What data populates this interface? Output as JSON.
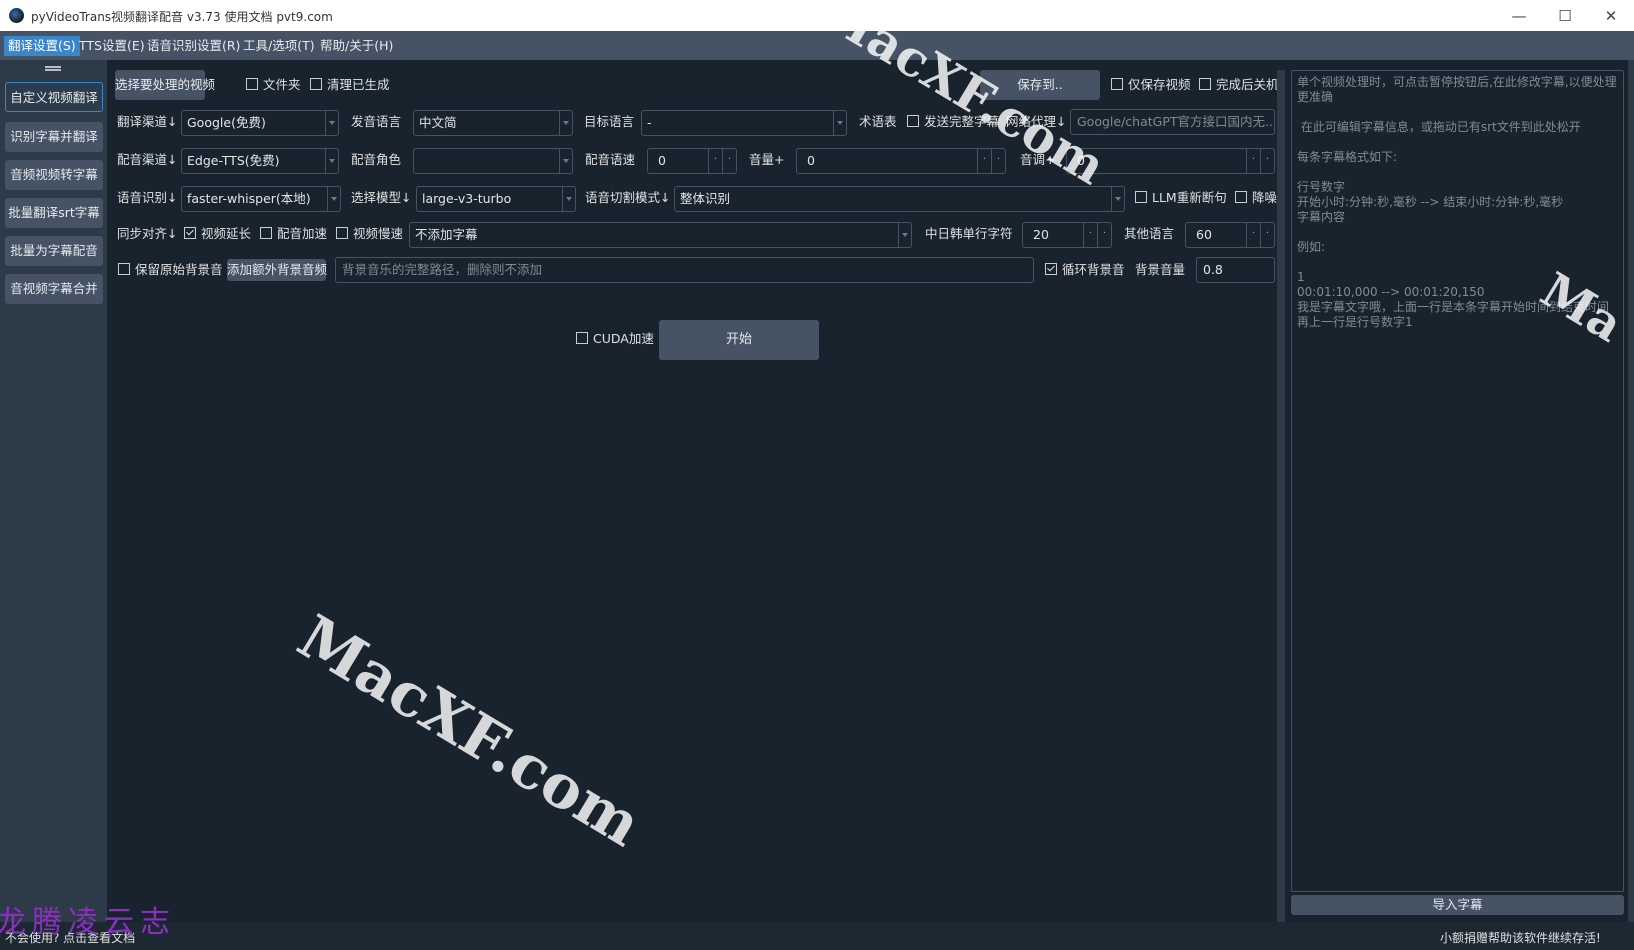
{
  "window": {
    "title": "pyVideoTrans视频翻译配音 v3.73  使用文档  pvt9.com"
  },
  "menu": [
    "翻译设置(S)",
    "TTS设置(E)",
    "语音识别设置(R)",
    "工具/选项(T)",
    "帮助/关于(H)"
  ],
  "sidebar": [
    "自定义视频翻译",
    "识别字幕并翻译",
    "音频视频转字幕",
    "批量翻译srt字幕",
    "批量为字幕配音",
    "音视频字幕合并"
  ],
  "top": {
    "select_video": "选择要处理的视频",
    "folder": "文件夹",
    "clear_generated": "清理已生成",
    "save_to": "保存到..",
    "only_save_video": "仅保存视频",
    "shutdown_after": "完成后关机"
  },
  "row1": {
    "trans_channel_label": "翻译渠道↓",
    "trans_channel_value": "Google(免费)",
    "source_lang_label": "发音语言",
    "source_lang_value": "中文简",
    "target_lang_label": "目标语言",
    "target_lang_value": "-",
    "glossary": "术语表",
    "send_full_subtitle": "发送完整字幕",
    "proxy_label": "网络代理↓",
    "proxy_placeholder": "Google/chatGPT官方接口国内无..."
  },
  "row2": {
    "dub_channel_label": "配音渠道↓",
    "dub_channel_value": "Edge-TTS(免费)",
    "dub_role_label": "配音角色",
    "dub_role_value": "",
    "dub_speed_label": "配音语速",
    "dub_speed_value": "0",
    "volume_label": "音量+",
    "volume_value": "0",
    "pitch_label": "音调+",
    "pitch_value": "0"
  },
  "row3": {
    "asr_label": "语音识别↓",
    "asr_value": "faster-whisper(本地)",
    "model_label": "选择模型↓",
    "model_value": "large-v3-turbo",
    "split_label": "语音切割模式↓",
    "split_value": "整体识别",
    "llm_resplit": "LLM重新断句",
    "denoise": "降噪"
  },
  "row4": {
    "sync_label": "同步对齐↓",
    "video_extend": "视频延长",
    "dub_accel": "配音加速",
    "video_slow": "视频慢速",
    "subtitle_mode": "不添加字幕",
    "cjk_chars_label": "中日韩单行字符",
    "cjk_chars_value": "20",
    "other_lang_label": "其他语言",
    "other_lang_value": "60"
  },
  "row5": {
    "keep_bg": "保留原始背景音",
    "add_bg_button": "添加额外背景音频",
    "bg_path_placeholder": "背景音乐的完整路径，删除则不添加",
    "loop_bg": "循环背景音",
    "bg_volume_label": "背景音量",
    "bg_volume_value": "0.8"
  },
  "action": {
    "cuda": "CUDA加速",
    "start": "开始"
  },
  "right_panel": {
    "text": "单个视频处理时，可点击暂停按钮后,在此修改字幕,以便处理更准确\n\n 在此可编辑字幕信息，或拖动已有srt文件到此处松开\n\n每条字幕格式如下:\n\n行号数字\n开始小时:分钟:秒,毫秒 --> 结束小时:分钟:秒,毫秒\n字幕内容\n\n例如:\n\n1\n00:01:10,000 --> 00:01:20,150\n我是字幕文字哦，上面一行是本条字幕开始时间到结束时间\n再上一行是行号数字1",
    "import_button": "导入字幕"
  },
  "status": {
    "help_link": "不会使用? 点击查看文档",
    "donate": "小额捐赠帮助该软件继续存活!"
  },
  "watermarks": [
    "MacXF.com",
    "MacXF.com",
    "MacXF.com",
    "Ma",
    "龙腾凌云志"
  ],
  "colors": {
    "background": "#19232d",
    "panel": "#455364",
    "accent": "#3b86c8"
  }
}
